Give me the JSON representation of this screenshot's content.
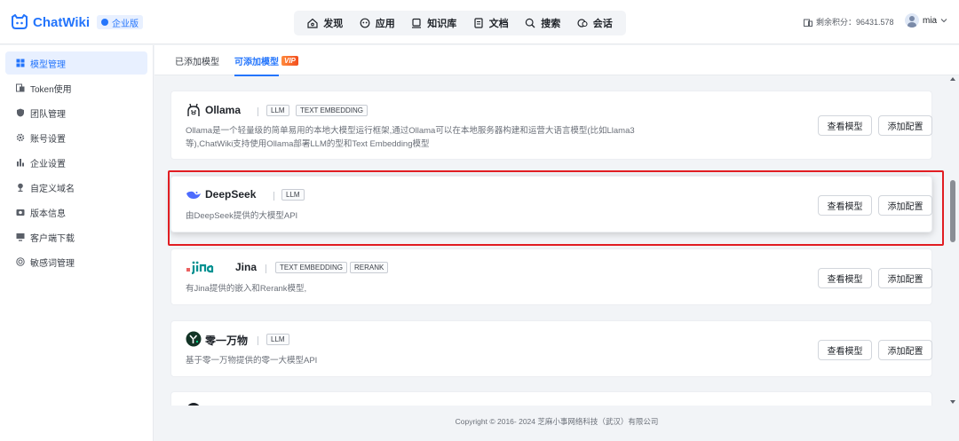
{
  "app": {
    "name": "ChatWiki",
    "edition": "企业版"
  },
  "nav": [
    {
      "label": "发现",
      "icon": "discover-icon"
    },
    {
      "label": "应用",
      "icon": "app-icon"
    },
    {
      "label": "知识库",
      "icon": "knowledge-base-icon"
    },
    {
      "label": "文档",
      "icon": "document-icon"
    },
    {
      "label": "搜索",
      "icon": "search-icon"
    },
    {
      "label": "会话",
      "icon": "chat-icon"
    }
  ],
  "header": {
    "points_label": "剩余积分：96431.578",
    "user_name": "mia"
  },
  "sidebar": {
    "items": [
      {
        "label": "模型管理",
        "icon": "model-icon",
        "active": true
      },
      {
        "label": "Token使用",
        "icon": "token-icon",
        "active": false
      },
      {
        "label": "团队管理",
        "icon": "team-icon",
        "active": false
      },
      {
        "label": "账号设置",
        "icon": "account-settings-icon",
        "active": false
      },
      {
        "label": "企业设置",
        "icon": "enterprise-icon",
        "active": false
      },
      {
        "label": "自定义域名",
        "icon": "domain-icon",
        "active": false
      },
      {
        "label": "版本信息",
        "icon": "version-icon",
        "active": false
      },
      {
        "label": "客户端下载",
        "icon": "download-icon",
        "active": false
      },
      {
        "label": "敏感词管理",
        "icon": "sensitive-words-icon",
        "active": false
      }
    ]
  },
  "tabs": [
    {
      "label": "已添加模型",
      "active": false
    },
    {
      "label": "可添加模型",
      "active": true,
      "badge": "VIP"
    }
  ],
  "buttons": {
    "view_models": "查看模型",
    "add_config": "添加配置"
  },
  "models": [
    {
      "name": "Ollama",
      "logo": "ollama-logo-icon",
      "tags": [
        "LLM",
        "TEXT EMBEDDING"
      ],
      "description": "Ollama是一个轻量级的简单易用的本地大模型运行框架,通过Ollama可以在本地服务器构建和运营大语言模型(比如Llama3等),ChatWiki支持使用Ollama部署LLM的型和Text Embedding模型"
    },
    {
      "name": "DeepSeek",
      "logo": "deepseek-logo-icon",
      "tags": [
        "LLM"
      ],
      "description": "由DeepSeek提供的大模型API"
    },
    {
      "name": "Jina",
      "logo": "jina-logo-icon",
      "tags": [
        "TEXT EMBEDDING",
        "RERANK"
      ],
      "description": "有Jina提供的嵌入和Rerank模型,"
    },
    {
      "name": "零一万物",
      "logo": "yi-logo-icon",
      "tags": [
        "LLM"
      ],
      "description": "基于零一万物提供的零一大模型API"
    }
  ],
  "footer": "Copyright © 2016- 2024 芝麻小事网络科技（武汉）有限公司",
  "colors": {
    "primary": "#2475fc",
    "highlight_border": "#e11d22",
    "vip_badge": "#f24e1e"
  }
}
